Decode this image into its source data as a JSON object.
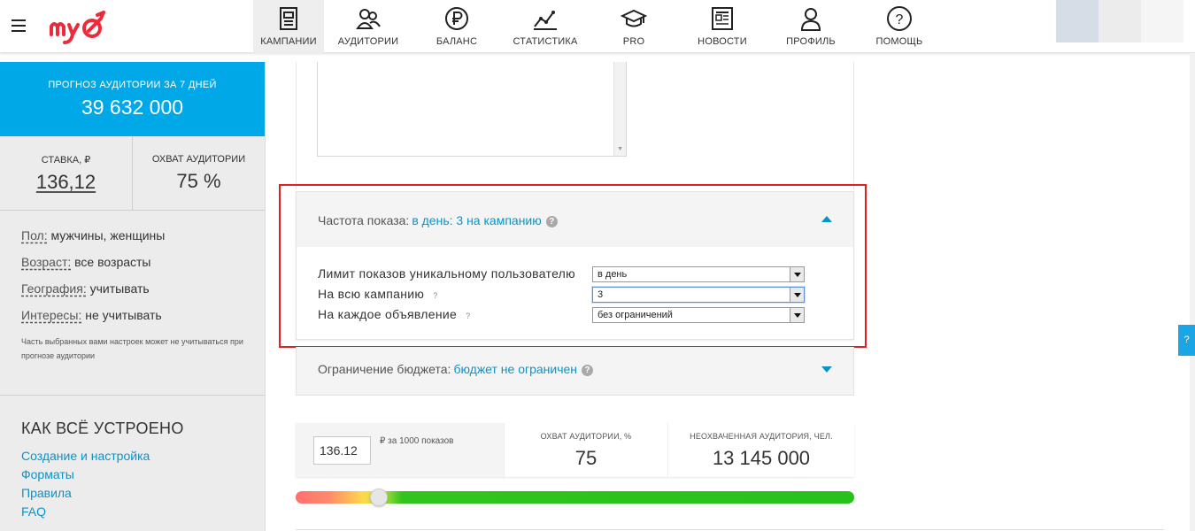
{
  "nav": {
    "items": [
      {
        "label": "КАМПАНИИ",
        "icon": "campaigns-icon",
        "active": true
      },
      {
        "label": "АУДИТОРИИ",
        "icon": "audiences-icon"
      },
      {
        "label": "БАЛАНС",
        "icon": "ruble-icon"
      },
      {
        "label": "СТАТИСТИКА",
        "icon": "chart-icon"
      },
      {
        "label": "PRO",
        "icon": "graduation-cap-icon"
      },
      {
        "label": "НОВОСТИ",
        "icon": "news-icon"
      },
      {
        "label": "ПРОФИЛЬ",
        "icon": "profile-icon"
      },
      {
        "label": "ПОМОЩЬ",
        "icon": "help-icon"
      }
    ]
  },
  "sidebar": {
    "forecast_label": "ПРОГНОЗ АУДИТОРИИ ЗА 7 ДНЕЙ",
    "forecast_value": "39 632 000",
    "rate_label": "СТАВКА, ₽",
    "rate_value": "136,12",
    "reach_label": "ОХВАТ АУДИТОРИИ",
    "reach_value": "75 %",
    "params": [
      {
        "key": "Пол:",
        "value": "мужчины, женщины"
      },
      {
        "key": "Возраст:",
        "value": "все возрасты"
      },
      {
        "key": "География:",
        "value": "учитывать"
      },
      {
        "key": "Интересы:",
        "value": "не учитывать"
      }
    ],
    "note": "Часть выбранных вами настроек может не учитываться при прогнозе аудитории",
    "how_title": "КАК ВСЁ УСТРОЕНО",
    "how_links": [
      "Создание и настройка",
      "Форматы",
      "Правила",
      "FAQ"
    ]
  },
  "frequency": {
    "title": "Частота показа:",
    "value": "в день: 3 на кампанию",
    "help": "?",
    "rows": [
      {
        "label": "Лимит показов уникальному пользователю",
        "has_help": false,
        "select_value": "в день"
      },
      {
        "label": "На всю кампанию",
        "has_help": true,
        "select_value": "3"
      },
      {
        "label": "На каждое объявление",
        "has_help": true,
        "select_value": "без ограничений"
      }
    ],
    "qmark": "?"
  },
  "budget": {
    "title": "Ограничение бюджета:",
    "value": "бюджет не ограничен",
    "help": "?"
  },
  "bid": {
    "input_value": "136.12",
    "unit": "₽ за 1000 показов",
    "reach_label": "ОХВАТ АУДИТОРИИ, %",
    "reach_value": "75",
    "uncovered_label": "НЕОХВАЧЕННАЯ АУДИТОРИЯ, ЧЕЛ.",
    "uncovered_value": "13 145 000",
    "slider_position": 0.15
  },
  "help_tab": "?",
  "colors": {
    "accent": "#00a8e7",
    "link": "#0a93c9",
    "highlight": "#e02020",
    "logo": "#ee2a3a",
    "slider_green": "#27c11b"
  }
}
